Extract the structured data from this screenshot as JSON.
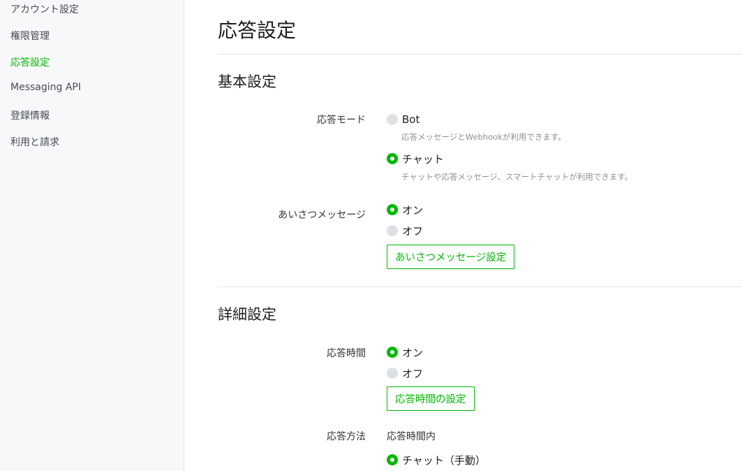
{
  "sidebar": {
    "items": [
      {
        "label": "アカウント設定"
      },
      {
        "label": "権限管理"
      },
      {
        "label": "応答設定",
        "active": true
      },
      {
        "label": "Messaging API"
      },
      {
        "label": "登録情報"
      },
      {
        "label": "利用と請求"
      }
    ]
  },
  "page": {
    "title": "応答設定"
  },
  "basic": {
    "title": "基本設定",
    "response_mode": {
      "label": "応答モード",
      "options": [
        {
          "label": "Bot",
          "hint": "応答メッセージとWebhookが利用できます。",
          "selected": false
        },
        {
          "label": "チャット",
          "hint": "チャットや応答メッセージ、スマートチャットが利用できます。",
          "selected": true
        }
      ]
    },
    "greeting": {
      "label": "あいさつメッセージ",
      "options": [
        {
          "label": "オン",
          "selected": true
        },
        {
          "label": "オフ",
          "selected": false
        }
      ],
      "button_label": "あいさつメッセージ設定"
    }
  },
  "detail": {
    "title": "詳細設定",
    "response_hours": {
      "label": "応答時間",
      "options": [
        {
          "label": "オン",
          "selected": true
        },
        {
          "label": "オフ",
          "selected": false
        }
      ],
      "button_label": "応答時間の設定"
    },
    "response_method": {
      "label": "応答方法",
      "value": "応答時間内",
      "options": [
        {
          "label": "チャット（手動）",
          "selected": true
        }
      ]
    }
  },
  "colors": {
    "accent": "#00b900",
    "sidebar_bg": "#f7f8f9",
    "radio_off": "#dde0e4",
    "hint_text": "#8c9197"
  }
}
